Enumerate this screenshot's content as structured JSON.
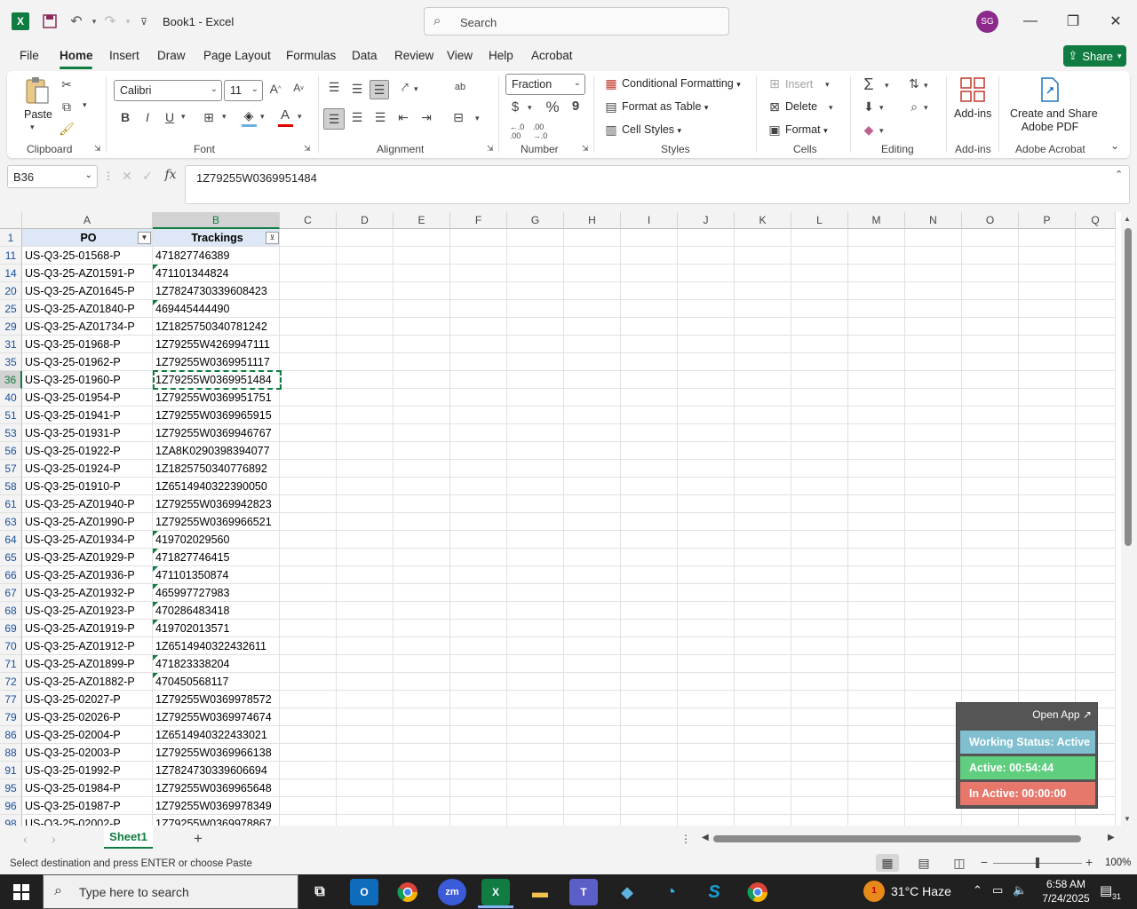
{
  "titlebar": {
    "doc_title": "Book1  -  Excel",
    "search_placeholder": "Search",
    "avatar_initials": "SG"
  },
  "menu_tabs": [
    "File",
    "Home",
    "Insert",
    "Draw",
    "Page Layout",
    "Formulas",
    "Data",
    "Review",
    "View",
    "Help",
    "Acrobat"
  ],
  "share_label": "Share",
  "ribbon": {
    "clipboard": {
      "paste": "Paste",
      "label": "Clipboard"
    },
    "font": {
      "name": "Calibri",
      "size": "11",
      "bold": "B",
      "italic": "I",
      "underline": "U",
      "label": "Font"
    },
    "alignment": {
      "label": "Alignment"
    },
    "number": {
      "format": "Fraction",
      "currency": "$",
      "percent": "%",
      "comma": "9",
      "label": "Number"
    },
    "styles": {
      "conditional": "Conditional Formatting",
      "format_table": "Format as Table",
      "cell_styles": "Cell Styles",
      "label": "Styles"
    },
    "cells": {
      "insert": "Insert",
      "delete": "Delete",
      "format": "Format",
      "label": "Cells"
    },
    "editing": {
      "label": "Editing"
    },
    "addins": {
      "button": "Add-ins",
      "label": "Add-ins"
    },
    "acrobat": {
      "button_line1": "Create and Share",
      "button_line2": "Adobe PDF",
      "label": "Adobe Acrobat"
    }
  },
  "formula_bar": {
    "name_box": "B36",
    "fx": "fx",
    "value": "1Z79255W0369951484"
  },
  "sheet": {
    "columns": [
      "A",
      "B",
      "C",
      "D",
      "E",
      "F",
      "G",
      "H",
      "I",
      "J",
      "K",
      "L",
      "M",
      "N",
      "O",
      "P",
      "Q"
    ],
    "header_row": {
      "row": "1",
      "a": "PO",
      "b": "Trackings"
    },
    "rows": [
      {
        "row": "11",
        "a": "US-Q3-25-01568-P",
        "b": "471827746389",
        "tri": false
      },
      {
        "row": "14",
        "a": "US-Q3-25-AZ01591-P",
        "b": "471101344824",
        "tri": true
      },
      {
        "row": "20",
        "a": "US-Q3-25-AZ01645-P",
        "b": "1Z7824730339608423",
        "tri": false
      },
      {
        "row": "25",
        "a": "US-Q3-25-AZ01840-P",
        "b": "469445444490",
        "tri": true
      },
      {
        "row": "29",
        "a": "US-Q3-25-AZ01734-P",
        "b": "1Z1825750340781242",
        "tri": false
      },
      {
        "row": "31",
        "a": "US-Q3-25-01968-P",
        "b": "1Z79255W4269947111",
        "tri": false
      },
      {
        "row": "35",
        "a": "US-Q3-25-01962-P",
        "b": "1Z79255W0369951117",
        "tri": false
      },
      {
        "row": "36",
        "a": "US-Q3-25-01960-P",
        "b": "1Z79255W0369951484",
        "tri": false
      },
      {
        "row": "40",
        "a": "US-Q3-25-01954-P",
        "b": "1Z79255W0369951751",
        "tri": false
      },
      {
        "row": "51",
        "a": "US-Q3-25-01941-P",
        "b": "1Z79255W0369965915",
        "tri": false
      },
      {
        "row": "53",
        "a": "US-Q3-25-01931-P",
        "b": "1Z79255W0369946767",
        "tri": false
      },
      {
        "row": "56",
        "a": "US-Q3-25-01922-P",
        "b": "1ZA8K0290398394077",
        "tri": false
      },
      {
        "row": "57",
        "a": "US-Q3-25-01924-P",
        "b": "1Z1825750340776892",
        "tri": false
      },
      {
        "row": "58",
        "a": "US-Q3-25-01910-P",
        "b": "1Z6514940322390050",
        "tri": false
      },
      {
        "row": "61",
        "a": "US-Q3-25-AZ01940-P",
        "b": "1Z79255W0369942823",
        "tri": false
      },
      {
        "row": "63",
        "a": "US-Q3-25-AZ01990-P",
        "b": "1Z79255W0369966521",
        "tri": false
      },
      {
        "row": "64",
        "a": "US-Q3-25-AZ01934-P",
        "b": "419702029560",
        "tri": true
      },
      {
        "row": "65",
        "a": "US-Q3-25-AZ01929-P",
        "b": "471827746415",
        "tri": true
      },
      {
        "row": "66",
        "a": "US-Q3-25-AZ01936-P",
        "b": "471101350874",
        "tri": true
      },
      {
        "row": "67",
        "a": "US-Q3-25-AZ01932-P",
        "b": "465997727983",
        "tri": true
      },
      {
        "row": "68",
        "a": "US-Q3-25-AZ01923-P",
        "b": "470286483418",
        "tri": true
      },
      {
        "row": "69",
        "a": "US-Q3-25-AZ01919-P",
        "b": "419702013571",
        "tri": true
      },
      {
        "row": "70",
        "a": "US-Q3-25-AZ01912-P",
        "b": "1Z6514940322432611",
        "tri": false
      },
      {
        "row": "71",
        "a": "US-Q3-25-AZ01899-P",
        "b": "471823338204",
        "tri": true
      },
      {
        "row": "72",
        "a": "US-Q3-25-AZ01882-P",
        "b": "470450568117",
        "tri": true
      },
      {
        "row": "77",
        "a": "US-Q3-25-02027-P",
        "b": "1Z79255W0369978572",
        "tri": false
      },
      {
        "row": "79",
        "a": "US-Q3-25-02026-P",
        "b": "1Z79255W0369974674",
        "tri": false
      },
      {
        "row": "86",
        "a": "US-Q3-25-02004-P",
        "b": "1Z6514940322433021",
        "tri": false
      },
      {
        "row": "88",
        "a": "US-Q3-25-02003-P",
        "b": "1Z79255W0369966138",
        "tri": false
      },
      {
        "row": "91",
        "a": "US-Q3-25-01992-P",
        "b": "1Z7824730339606694",
        "tri": false
      },
      {
        "row": "95",
        "a": "US-Q3-25-01984-P",
        "b": "1Z79255W0369965648",
        "tri": false
      },
      {
        "row": "96",
        "a": "US-Q3-25-01987-P",
        "b": "1Z79255W0369978349",
        "tri": false
      },
      {
        "row": "98",
        "a": "US-Q3-25-02002-P",
        "b": "1Z79255W0369978867",
        "tri": false
      }
    ],
    "selected_cell": "B36"
  },
  "widget": {
    "open_app": "Open App ↗",
    "status": "Working Status: Active",
    "active": "Active: 00:54:44",
    "inactive": "In Active: 00:00:00",
    "colors": {
      "status": "#7fbfcf",
      "active": "#5fcf7f",
      "inactive": "#e8776b"
    }
  },
  "sheet_tab": "Sheet1",
  "status_bar": {
    "message": "Select destination and press ENTER or choose Paste",
    "zoom": "100%"
  },
  "taskbar": {
    "search_placeholder": "Type here to search",
    "weather": "31°C  Haze",
    "weather_badge": "1",
    "time": "6:58 AM",
    "date": "7/24/2025",
    "notif_count": "31"
  },
  "colors": {
    "accent": "#107c41",
    "header_fill": "#dde7f5"
  }
}
